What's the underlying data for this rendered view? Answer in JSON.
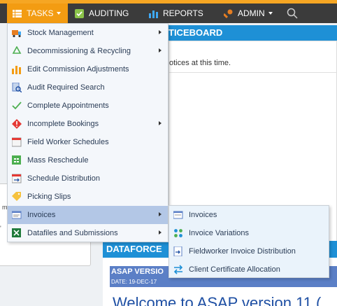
{
  "nav": {
    "tasks": "TASKS",
    "auditing": "AUDITING",
    "reports": "REPORTS",
    "admin": "ADMIN"
  },
  "noticeboard": {
    "header": "TICEBOARD",
    "message": "otices at this time."
  },
  "dataforce": {
    "header": "DATAFORCE",
    "version_title": "ASAP VERSIO",
    "version_date": "DATE: 19-DEC-17",
    "welcome": "Welcome to ASAP version 11 ("
  },
  "left_fragments": {
    "a": "m",
    "b": "'"
  },
  "tasks_menu": [
    {
      "label": "Stock Management",
      "icon": "truck-icon",
      "has_submenu": true
    },
    {
      "label": "Decommissioning & Recycling",
      "icon": "recycle-icon",
      "has_submenu": true
    },
    {
      "label": "Edit Commission Adjustments",
      "icon": "bar-chart-icon",
      "has_submenu": false
    },
    {
      "label": "Audit Required Search",
      "icon": "document-search-icon",
      "has_submenu": false
    },
    {
      "label": "Complete Appointments",
      "icon": "checkmark-icon",
      "has_submenu": false
    },
    {
      "label": "Incomplete Bookings",
      "icon": "warning-icon",
      "has_submenu": true
    },
    {
      "label": "Field Worker Schedules",
      "icon": "calendar-icon",
      "has_submenu": false
    },
    {
      "label": "Mass Reschedule",
      "icon": "grid-icon",
      "has_submenu": false
    },
    {
      "label": "Schedule Distribution",
      "icon": "calendar-arrow-icon",
      "has_submenu": false
    },
    {
      "label": "Picking Slips",
      "icon": "tag-icon",
      "has_submenu": false
    },
    {
      "label": "Invoices",
      "icon": "invoice-icon",
      "has_submenu": true
    },
    {
      "label": "Datafiles and Submissions",
      "icon": "excel-icon",
      "has_submenu": true
    }
  ],
  "invoices_submenu": [
    {
      "label": "Invoices",
      "icon": "invoice-icon"
    },
    {
      "label": "Invoice Variations",
      "icon": "dots-grid-icon"
    },
    {
      "label": "Fieldworker Invoice Distribution",
      "icon": "document-arrow-icon"
    },
    {
      "label": "Client Certificate Allocation",
      "icon": "transfer-icon"
    }
  ],
  "colors": {
    "nav_bg": "#3b3b3b",
    "tasks_active": "#f39c12",
    "header_blue": "#1e90d6",
    "menu_bg": "#f4f7fb",
    "menu_active": "#b3c7e6",
    "submenu_bg": "#eaf3fb"
  }
}
